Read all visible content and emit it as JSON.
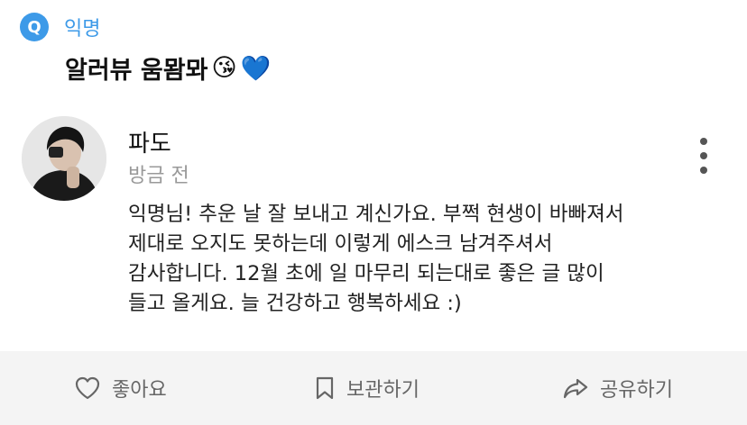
{
  "header": {
    "badge": "Q",
    "label": "익명"
  },
  "question": {
    "text": "알러뷰 움뫔뫄",
    "emojis": [
      "😘",
      "💙"
    ]
  },
  "answer": {
    "author": "파도",
    "time": "방금 전",
    "body": "익명님! 추운 날 잘 보내고 계신가요. 부쩍 현생이 바빠져서\n제대로 오지도 못하는데 이렇게 에스크 남겨주셔서\n감사합니다. 12월 초에 일 마무리 되는대로 좋은 글 많이\n들고 올게요. 늘 건강하고 행복하세요 :)"
  },
  "actions": {
    "like": "좋아요",
    "save": "보관하기",
    "share": "공유하기"
  },
  "colors": {
    "accent": "#3d9ae8",
    "muted": "#999999",
    "bar": "#f4f4f4"
  },
  "icons": [
    "heart-icon",
    "bookmark-icon",
    "share-icon",
    "more-vertical-icon"
  ]
}
